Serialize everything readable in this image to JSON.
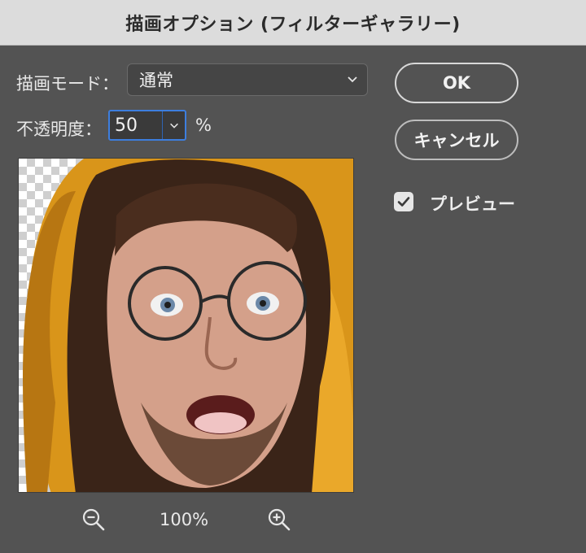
{
  "dialog": {
    "title": "描画オプション (フィルターギャラリー)"
  },
  "mode": {
    "label": "描画モード：",
    "value": "通常",
    "icon": "chevron-down-icon"
  },
  "opacity": {
    "label": "不透明度：",
    "value": "50",
    "unit": "%",
    "icon": "chevron-down-icon"
  },
  "buttons": {
    "ok": "OK",
    "cancel": "キャンセル"
  },
  "preview_toggle": {
    "label": "プレビュー",
    "checked": true
  },
  "zoom": {
    "level": "100%",
    "zoom_out_icon": "zoom-out-icon",
    "zoom_in_icon": "zoom-in-icon"
  },
  "colors": {
    "dialog_bg": "#535353",
    "titlebar_bg": "#dcdcdc",
    "focus_ring": "#3d7ede",
    "hood": "#e1a11a",
    "skin": "#d7a58e"
  }
}
